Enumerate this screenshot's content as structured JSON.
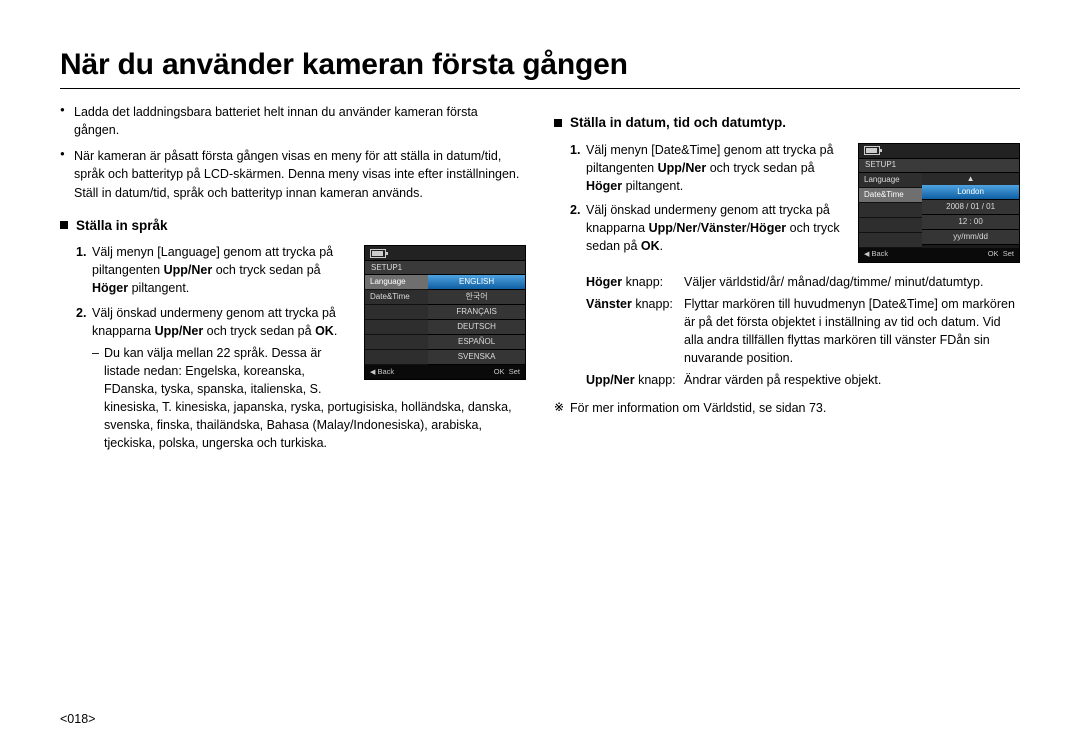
{
  "title": "När du använder kameran första gången",
  "intro_bullets": [
    "Ladda det laddningsbara batteriet helt innan du använder kameran första gången.",
    "När kameran är påsatt första gången visas en meny för att ställa in datum/tid, språk och batterityp på LCD-skärmen. Denna meny visas inte efter inställningen. Ställ in datum/tid, språk och batterityp innan kameran används."
  ],
  "left": {
    "heading": "Ställa in språk",
    "step1_pre": "Välj menyn [Language] genom att trycka på piltangenten ",
    "step1_b1": "Upp/Ner",
    "step1_mid": " och tryck sedan på ",
    "step1_b2": "Höger",
    "step1_post": " piltangent.",
    "step2_pre": "Välj önskad undermeny genom att trycka på knapparna ",
    "step2_b1": "Upp/Ner",
    "step2_mid": " och tryck sedan på ",
    "step2_b2": "OK",
    "step2_post": ".",
    "sub_a": "Du kan välja mellan 22 språk. Dessa är listade nedan: Engelska, koreanska, FDanska, tyska, spanska, italienska, S. kinesiska, T. kinesiska, japanska, ryska, portugisiska, holländska, danska, svenska, finska, thailändska, Bahasa (Malay/Indonesiska), arabiska, tjeckiska, polska, ungerska och turkiska."
  },
  "right": {
    "heading": "Ställa in datum, tid och datumtyp.",
    "step1_pre": "Välj menyn [Date&Time] genom att trycka på piltangenten ",
    "step1_b1": "Upp/Ner",
    "step1_mid": " och tryck sedan på ",
    "step1_b2": "Höger",
    "step1_post": " piltangent.",
    "step2_pre": "Välj önskad undermeny genom att trycka på knapparna ",
    "step2_b1": "Upp",
    "step2_b2": "Ner",
    "step2_b3": "Vänster",
    "step2_b4": "Höger",
    "step2_mid": " och tryck sedan på ",
    "step2_b5": "OK",
    "step2_post": ".",
    "defs": [
      {
        "term_b": "Höger",
        "term_rest": " knapp:",
        "desc": "Väljer världstid/år/ månad/dag/timme/ minut/datumtyp."
      },
      {
        "term_b": "Vänster",
        "term_rest": " knapp:",
        "desc": "Flyttar markören till huvudmenyn [Date&Time] om markören är på det första objektet i inställning av tid och datum. Vid alla andra tillfällen flyttas markören till vänster FDån sin nuvarande position."
      },
      {
        "term_b": "Upp/Ner",
        "term_rest": " knapp:",
        "desc": "Ändrar värden på respektive objekt."
      }
    ],
    "note": "För mer information om Världstid, se sidan 73."
  },
  "lcd_lang": {
    "tab": "SETUP1",
    "left_rows": [
      "Language",
      "Date&Time"
    ],
    "left_selected": 0,
    "options": [
      "ENGLISH",
      "한국어",
      "FRANÇAIS",
      "DEUTSCH",
      "ESPAÑOL",
      "SVENSKA"
    ],
    "opt_selected": 0,
    "footer_back": "Back",
    "footer_ok": "OK",
    "footer_set": "Set"
  },
  "lcd_date": {
    "tab": "SETUP1",
    "left_rows": [
      "Language",
      "Date&Time"
    ],
    "left_selected": 1,
    "options": [
      "London",
      "2008 / 01 / 01",
      "12 : 00",
      "yy/mm/dd"
    ],
    "opt_selected": 0,
    "footer_back": "Back",
    "footer_ok": "OK",
    "footer_set": "Set"
  },
  "page_number": "<018>"
}
